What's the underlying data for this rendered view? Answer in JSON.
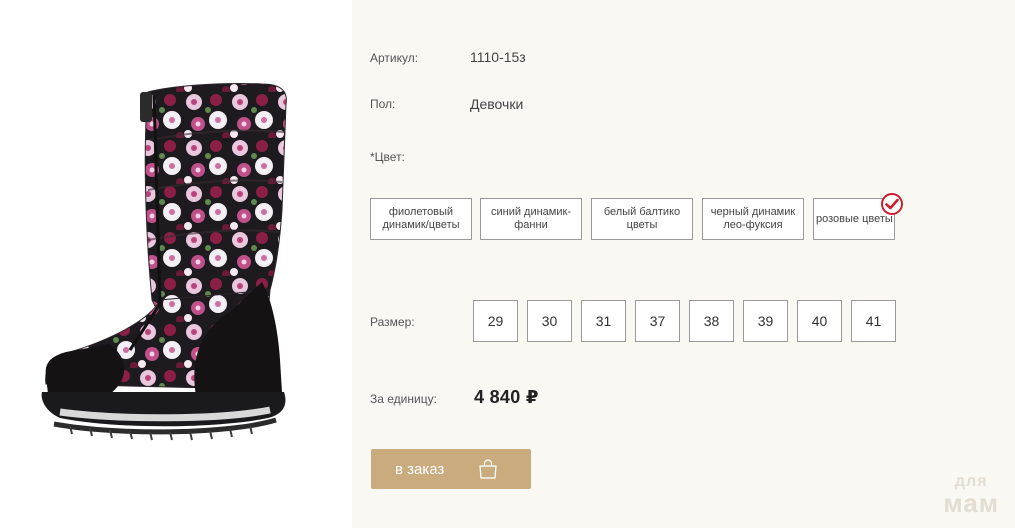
{
  "product": {
    "image_alt": "product-boot-image"
  },
  "details": {
    "article_label": "Артикул:",
    "article_value": "1110-15з",
    "gender_label": "Пол:",
    "gender_value": "Девочки",
    "color_label": "*Цвет:"
  },
  "colors": [
    {
      "label_line1": "фиолетовый",
      "label_line2": "динамик/цветы",
      "selected": false
    },
    {
      "label_line1": "синий динамик-",
      "label_line2": "фанни",
      "selected": false
    },
    {
      "label_line1": "белый балтико",
      "label_line2": "цветы",
      "selected": false
    },
    {
      "label_line1": "черный динамик",
      "label_line2": "лео-фуксия",
      "selected": false
    },
    {
      "label_line1": "розовые цветы",
      "label_line2": "",
      "selected": true
    }
  ],
  "sizes": {
    "label": "Размер:",
    "options": [
      "29",
      "30",
      "31",
      "37",
      "38",
      "39",
      "40",
      "41"
    ]
  },
  "price": {
    "label": "За единицу:",
    "value": "4 840 ₽"
  },
  "order": {
    "button_label": "в заказ"
  },
  "watermark": {
    "line1": "для",
    "line2": "мам"
  },
  "theme": {
    "accent": "#c9ab7e",
    "check": "#cc1f2d"
  }
}
